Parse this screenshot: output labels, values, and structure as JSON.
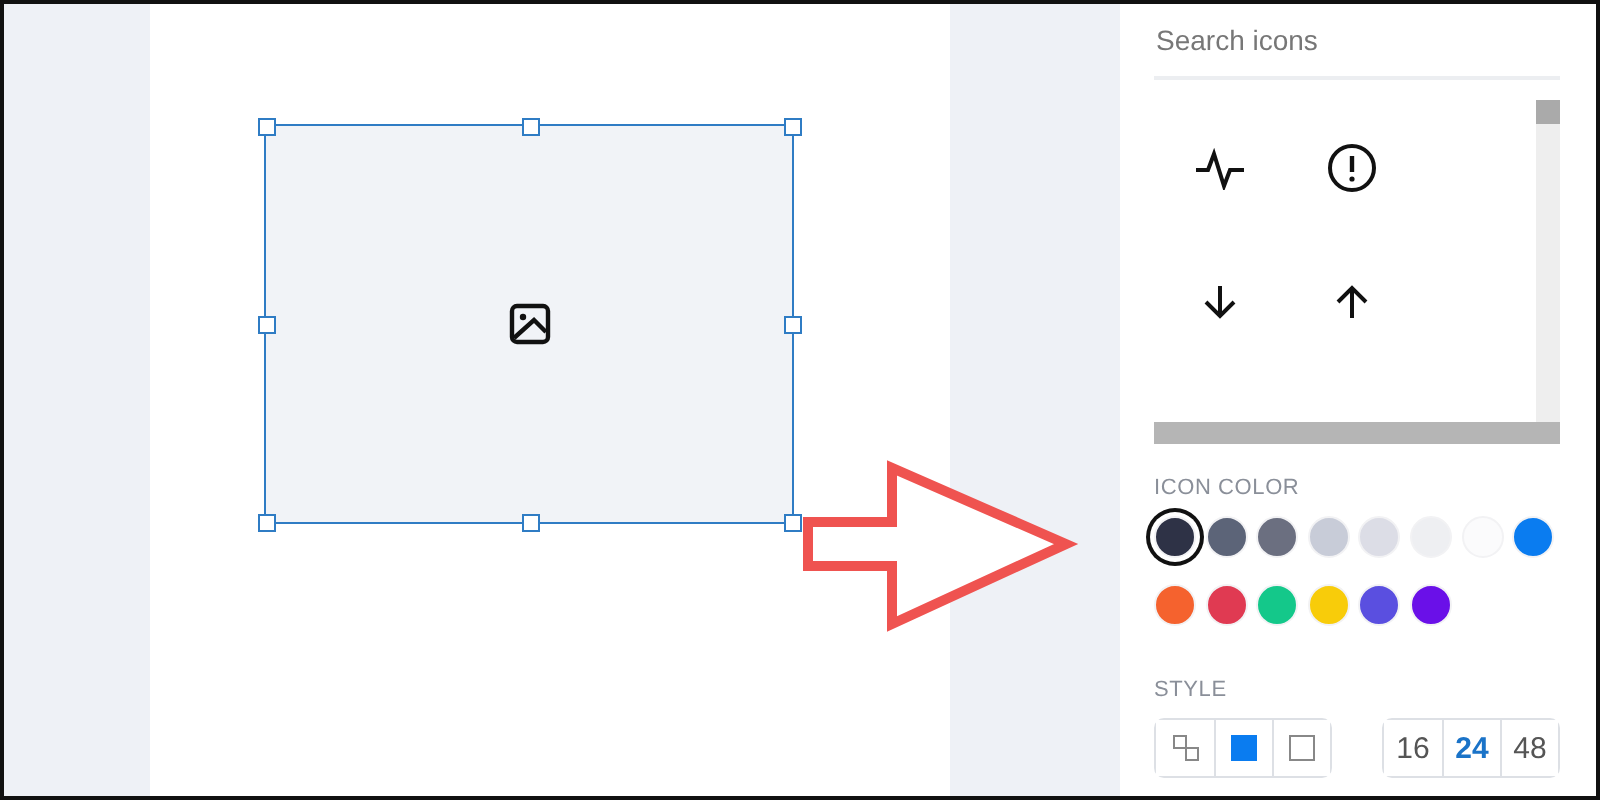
{
  "search": {
    "placeholder": "Search icons"
  },
  "icons": [
    {
      "kind": "pulse"
    },
    {
      "kind": "alert"
    },
    {
      "kind": "arrow-down"
    },
    {
      "kind": "arrow-up"
    }
  ],
  "icon_color": {
    "label": "ICON COLOR",
    "colors": [
      {
        "color": "#2e3246",
        "selected": true
      },
      {
        "color": "#5c6478",
        "selected": false
      },
      {
        "color": "#6b6f80",
        "selected": false
      },
      {
        "color": "#c8ccd8",
        "selected": false
      },
      {
        "color": "#dcdde6",
        "selected": false
      },
      {
        "color": "#eeeff2",
        "selected": false
      },
      {
        "color": "#fbfbfc",
        "selected": false
      },
      {
        "color": "#0a7cf0",
        "selected": false
      },
      {
        "color": "#f5622e",
        "selected": false
      },
      {
        "color": "#e03a52",
        "selected": false
      },
      {
        "color": "#14c88a",
        "selected": false
      },
      {
        "color": "#f8cc0a",
        "selected": false
      },
      {
        "color": "#5a4fe0",
        "selected": false
      },
      {
        "color": "#6a10e8",
        "selected": false
      }
    ]
  },
  "style": {
    "label": "STYLE",
    "options": [
      {
        "kind": "outline-pair",
        "selected": false
      },
      {
        "kind": "filled",
        "selected": true
      },
      {
        "kind": "outline",
        "selected": false
      }
    ]
  },
  "sizes": [
    {
      "label": "16",
      "selected": false
    },
    {
      "label": "24",
      "selected": true
    },
    {
      "label": "48",
      "selected": false
    }
  ]
}
